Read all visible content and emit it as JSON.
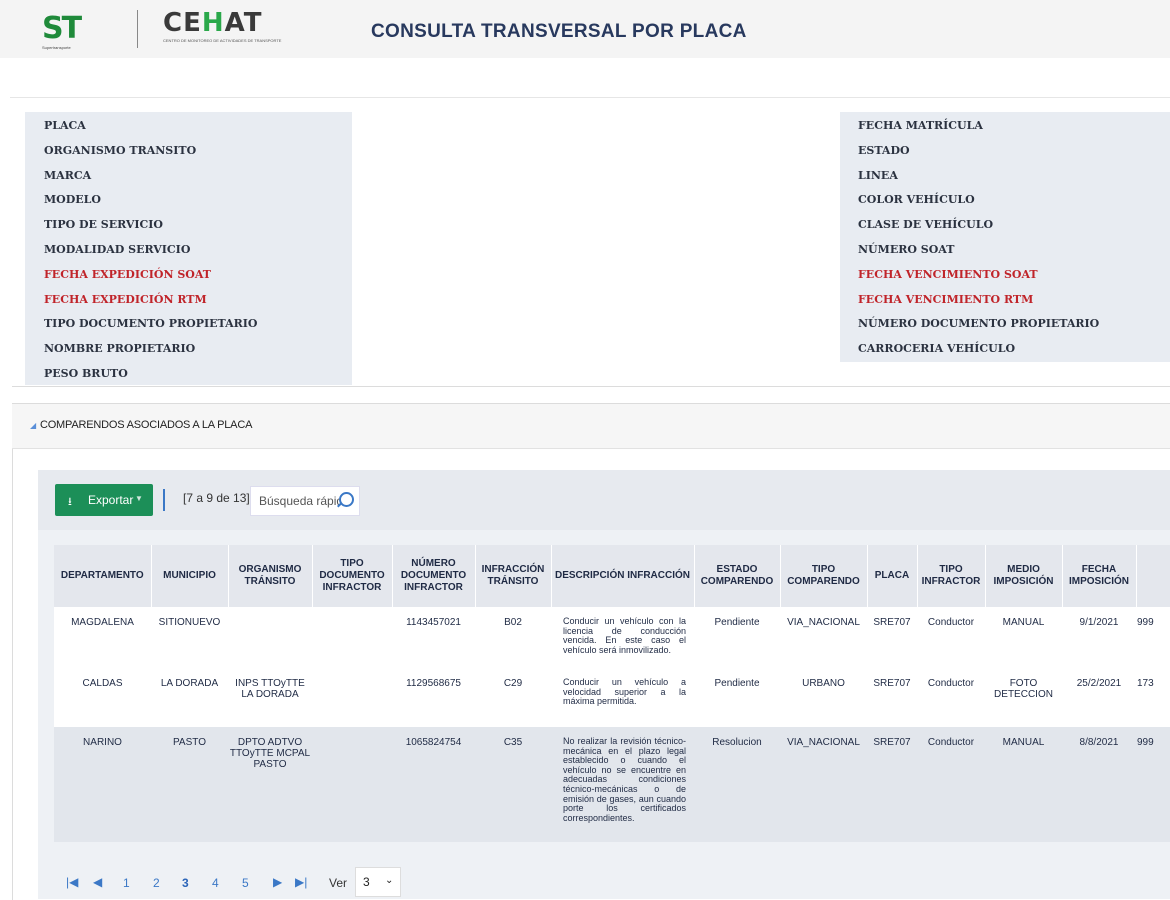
{
  "header": {
    "logo_st": {
      "mark_left": "S",
      "mark_right": "T",
      "subtitle": "Supertransporte"
    },
    "logo_cehat": {
      "mark_left": "CE",
      "mark_mid": "H",
      "mark_right": "AT",
      "subtitle": "CENTRO DE MONITOREO DE ACTIVIDADES DE TRANSPORTE"
    },
    "title": "CONSULTA TRANSVERSAL POR PLACA"
  },
  "info": {
    "left": [
      {
        "label": "PLACA",
        "red": false
      },
      {
        "label": "ORGANISMO TRANSITO",
        "red": false
      },
      {
        "label": "MARCA",
        "red": false
      },
      {
        "label": "MODELO",
        "red": false
      },
      {
        "label": "TIPO DE SERVICIO",
        "red": false
      },
      {
        "label": "MODALIDAD SERVICIO",
        "red": false
      },
      {
        "label": "FECHA EXPEDICIÓN SOAT",
        "red": true
      },
      {
        "label": "FECHA EXPEDICIÓN RTM",
        "red": true
      },
      {
        "label": "TIPO DOCUMENTO PROPIETARIO",
        "red": false
      },
      {
        "label": "NOMBRE PROPIETARIO",
        "red": false
      },
      {
        "label": "PESO BRUTO",
        "red": false
      }
    ],
    "right": [
      {
        "label": "FECHA MATRÍCULA",
        "red": false
      },
      {
        "label": "ESTADO",
        "red": false
      },
      {
        "label": "LINEA",
        "red": false
      },
      {
        "label": "COLOR VEHÍCULO",
        "red": false
      },
      {
        "label": "CLASE DE VEHÍCULO",
        "red": false
      },
      {
        "label": "NÚMERO SOAT",
        "red": false
      },
      {
        "label": "FECHA VENCIMIENTO SOAT",
        "red": true
      },
      {
        "label": "FECHA VENCIMIENTO RTM",
        "red": true
      },
      {
        "label": "NÚMERO DOCUMENTO PROPIETARIO",
        "red": false
      },
      {
        "label": "CARROCERIA VEHÍCULO",
        "red": false
      }
    ]
  },
  "comparendos": {
    "section_title": "COMPARENDOS ASOCIADOS A LA PLACA",
    "toolbar": {
      "export_label": "Exportar",
      "range_text": "[7 a 9 de 13]",
      "search_placeholder": "Búsqueda rápida"
    },
    "columns": [
      "DEPARTAMENTO",
      "MUNICIPIO",
      "ORGANISMO TRÁNSITO",
      "TIPO DOCUMENTO INFRACTOR",
      "NÚMERO DOCUMENTO INFRACTOR",
      "INFRACCIÓN TRÁNSITO",
      "DESCRIPCIÓN INFRACCIÓN",
      "ESTADO COMPARENDO",
      "TIPO COMPARENDO",
      "PLACA",
      "TIPO INFRACTOR",
      "MEDIO IMPOSICIÓN",
      "FECHA IMPOSICIÓN",
      ""
    ],
    "rows": [
      [
        "MAGDALENA",
        "SITIONUEVO",
        "",
        "",
        "1143457021",
        "B02",
        "Conducir un vehículo con la licencia de conducción vencida. En este caso el vehículo será inmovilizado.",
        "Pendiente",
        "VIA_NACIONAL",
        "SRE707",
        "Conductor",
        "MANUAL",
        "9/1/2021",
        "999"
      ],
      [
        "CALDAS",
        "LA DORADA",
        "INPS TTOyTTE LA DORADA",
        "",
        "1129568675",
        "C29",
        "Conducir un vehículo a velocidad superior a la máxima permitida.",
        "Pendiente",
        "URBANO",
        "SRE707",
        "Conductor",
        "FOTO DETECCION",
        "25/2/2021",
        "173"
      ],
      [
        "NARINO",
        "PASTO",
        "DPTO ADTVO TTOyTTE MCPAL PASTO",
        "",
        "1065824754",
        "C35",
        "No realizar la revisión técnico-mecánica en el plazo legal establecido o cuando el vehículo no se encuentre en adecuadas condiciones técnico-mecánicas o de emisión de gases, aun cuando porte los certificados correspondientes.",
        "Resolucion",
        "VIA_NACIONAL",
        "SRE707",
        "Conductor",
        "MANUAL",
        "8/8/2021",
        "999"
      ]
    ],
    "pager": {
      "pages": [
        "1",
        "2",
        "3",
        "4",
        "5"
      ],
      "current": "3",
      "ver_label": "Ver",
      "per_page": "3"
    }
  },
  "colors": {
    "title": "#28395e",
    "red_label": "#c0242a",
    "export_green": "#1c8f58",
    "link_blue": "#3b78c6"
  },
  "icons": [
    "download-icon",
    "dropdown-caret-icon",
    "search-icon",
    "first-page-icon",
    "prev-page-icon",
    "next-page-icon",
    "last-page-icon",
    "collapse-caret-icon",
    "select-chevron-icon"
  ]
}
